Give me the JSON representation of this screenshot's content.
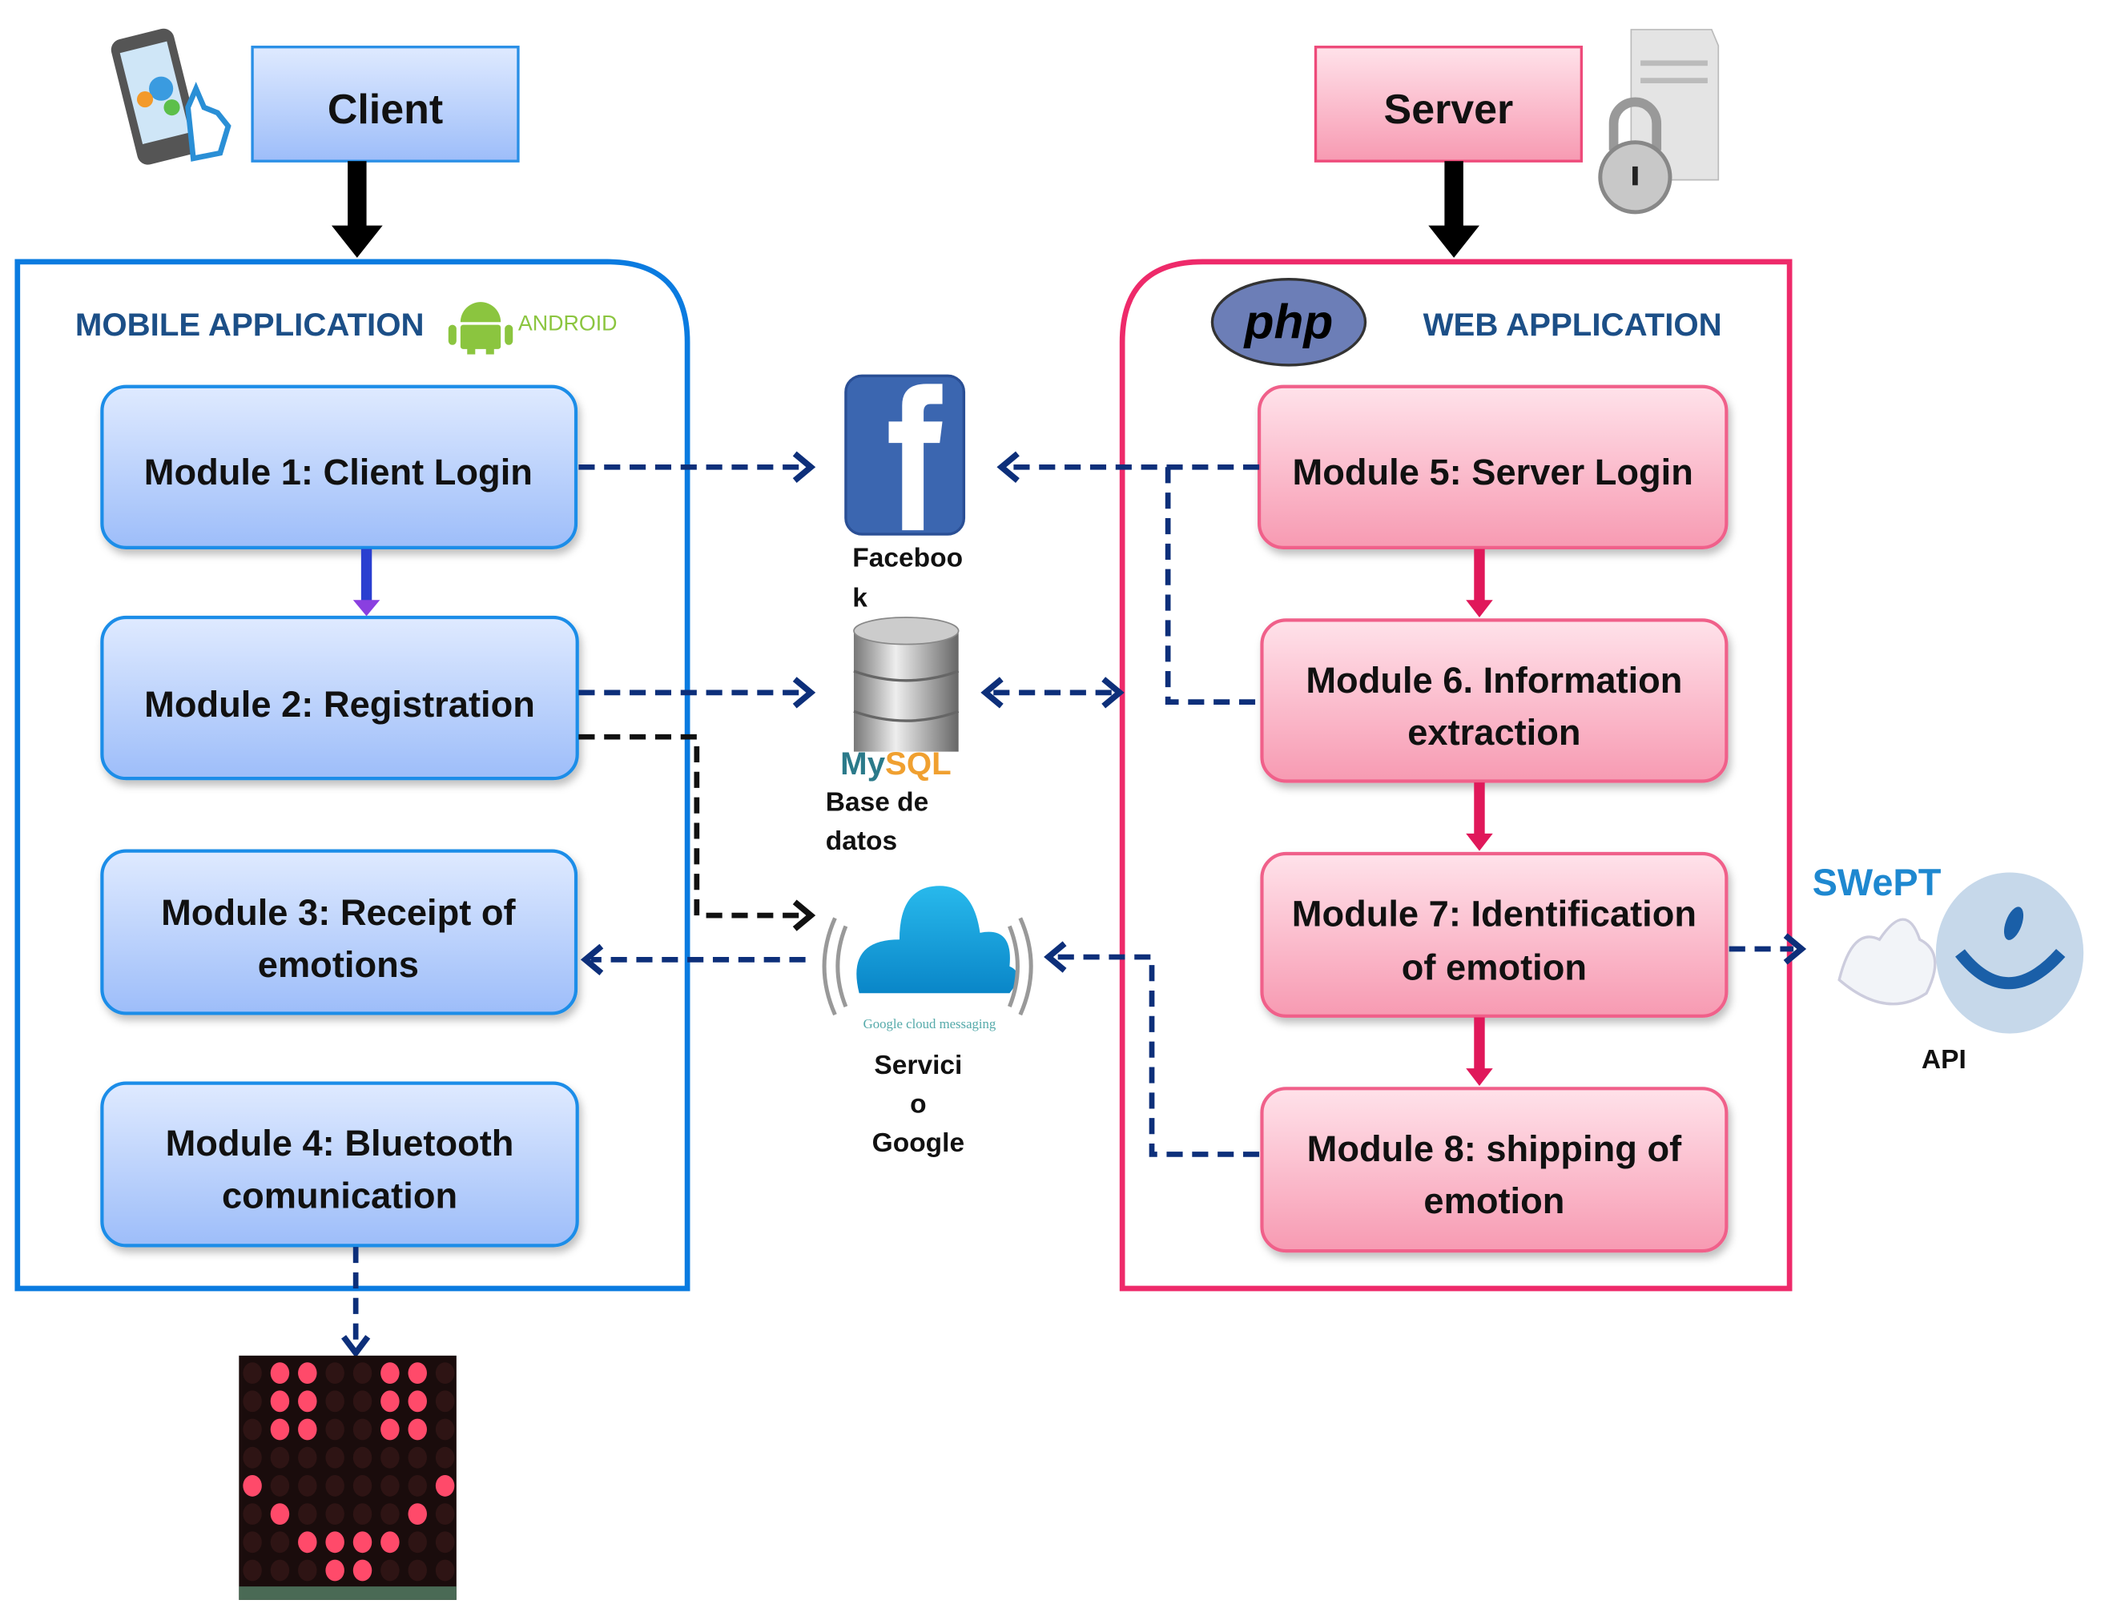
{
  "client": {
    "label": "Client"
  },
  "server": {
    "label": "Server"
  },
  "mobile_app": {
    "title": "MOBILE APPLICATION",
    "logo": "android",
    "modules": [
      {
        "lines": [
          "Module 1: Client Login"
        ]
      },
      {
        "lines": [
          "Module 2: Registration"
        ]
      },
      {
        "lines": [
          "Module 3: Receipt of",
          "emotions"
        ]
      },
      {
        "lines": [
          "Module 4: Bluetooth",
          "comunication"
        ]
      }
    ]
  },
  "web_app": {
    "title": "WEB APPLICATION",
    "logo": "php",
    "modules": [
      {
        "lines": [
          "Module 5: Server Login"
        ]
      },
      {
        "lines": [
          "Module 6. Information",
          "extraction"
        ]
      },
      {
        "lines": [
          "Module 7: Identification",
          "of emotion"
        ]
      },
      {
        "lines": [
          "Module 8: shipping of",
          "emotion"
        ]
      }
    ]
  },
  "services": {
    "facebook": {
      "lines": [
        "Faceboo",
        "k"
      ],
      "icon": "facebook-icon"
    },
    "database": {
      "lines": [
        "Base de",
        "datos"
      ],
      "icon": "mysql-database-icon",
      "logo_text": "MySQL"
    },
    "google": {
      "lines": [
        "Servici",
        "o",
        "Google"
      ],
      "icon": "google-cloud-messaging-icon"
    },
    "api": {
      "label": "API",
      "logo_text": "SWePT",
      "icon": "swept-smiley-icon"
    }
  },
  "colors": {
    "client_blue": "#0a7be0",
    "server_pink": "#ee2a6a",
    "dashed_navy": "#0d2f7a",
    "title_blue": "#1c4f87"
  }
}
